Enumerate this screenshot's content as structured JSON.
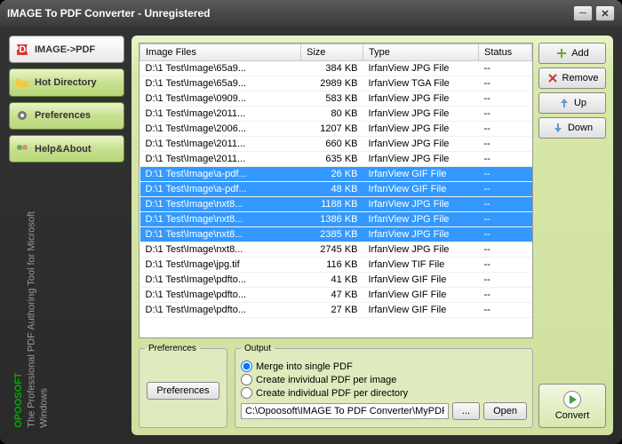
{
  "title": "IMAGE To PDF Converter - Unregistered",
  "nav": {
    "imagepdf": "IMAGE->PDF",
    "hotdir": "Hot Directory",
    "prefs": "Preferences",
    "help": "Help&About"
  },
  "branding": {
    "name": "OPOOSOFT",
    "tagline": "The Professional PDF Authoring Tool for Microsoft Windows"
  },
  "actions": {
    "add": "Add",
    "remove": "Remove",
    "up": "Up",
    "down": "Down",
    "convert": "Convert",
    "browse": "...",
    "open": "Open",
    "prefbtn": "Preferences"
  },
  "table": {
    "headers": {
      "files": "Image Files",
      "size": "Size",
      "type": "Type",
      "status": "Status"
    },
    "rows": [
      {
        "f": "D:\\1 Test\\Image\\65a9...",
        "s": "384 KB",
        "t": "IrfanView JPG File",
        "st": "--",
        "sel": false
      },
      {
        "f": "D:\\1 Test\\Image\\65a9...",
        "s": "2989 KB",
        "t": "IrfanView TGA File",
        "st": "--",
        "sel": false
      },
      {
        "f": "D:\\1 Test\\Image\\0909...",
        "s": "583 KB",
        "t": "IrfanView JPG File",
        "st": "--",
        "sel": false
      },
      {
        "f": "D:\\1 Test\\Image\\2011...",
        "s": "80 KB",
        "t": "IrfanView JPG File",
        "st": "--",
        "sel": false
      },
      {
        "f": "D:\\1 Test\\Image\\2006...",
        "s": "1207 KB",
        "t": "IrfanView JPG File",
        "st": "--",
        "sel": false
      },
      {
        "f": "D:\\1 Test\\Image\\2011...",
        "s": "660 KB",
        "t": "IrfanView JPG File",
        "st": "--",
        "sel": false
      },
      {
        "f": "D:\\1 Test\\Image\\2011...",
        "s": "635 KB",
        "t": "IrfanView JPG File",
        "st": "--",
        "sel": false
      },
      {
        "f": "D:\\1 Test\\Image\\a-pdf...",
        "s": "26 KB",
        "t": "IrfanView GIF File",
        "st": "--",
        "sel": true
      },
      {
        "f": "D:\\1 Test\\Image\\a-pdf...",
        "s": "48 KB",
        "t": "IrfanView GIF File",
        "st": "--",
        "sel": true
      },
      {
        "f": "D:\\1 Test\\Image\\nxt8...",
        "s": "1188 KB",
        "t": "IrfanView JPG File",
        "st": "--",
        "sel": true
      },
      {
        "f": "D:\\1 Test\\Image\\nxt8...",
        "s": "1386 KB",
        "t": "IrfanView JPG File",
        "st": "--",
        "sel": true
      },
      {
        "f": "D:\\1 Test\\Image\\nxt8...",
        "s": "2385 KB",
        "t": "IrfanView JPG File",
        "st": "--",
        "sel": true
      },
      {
        "f": "D:\\1 Test\\Image\\nxt8...",
        "s": "2745 KB",
        "t": "IrfanView JPG File",
        "st": "--",
        "sel": false
      },
      {
        "f": "D:\\1 Test\\Image\\jpg.tif",
        "s": "116 KB",
        "t": "IrfanView TIF File",
        "st": "--",
        "sel": false
      },
      {
        "f": "D:\\1 Test\\Image\\pdfto...",
        "s": "41 KB",
        "t": "IrfanView GIF File",
        "st": "--",
        "sel": false
      },
      {
        "f": "D:\\1 Test\\Image\\pdfto...",
        "s": "47 KB",
        "t": "IrfanView GIF File",
        "st": "--",
        "sel": false
      },
      {
        "f": "D:\\1 Test\\Image\\pdfto...",
        "s": "27 KB",
        "t": "IrfanView GIF File",
        "st": "--",
        "sel": false
      }
    ]
  },
  "prefs": {
    "label": "Preferences"
  },
  "output": {
    "label": "Output",
    "opt1": "Merge into single PDF",
    "opt2": "Create invividual PDF per image",
    "opt3": "Create individual PDF per directory",
    "path": "C:\\Opoosoft\\IMAGE To PDF Converter\\MyPDF.pdf"
  }
}
